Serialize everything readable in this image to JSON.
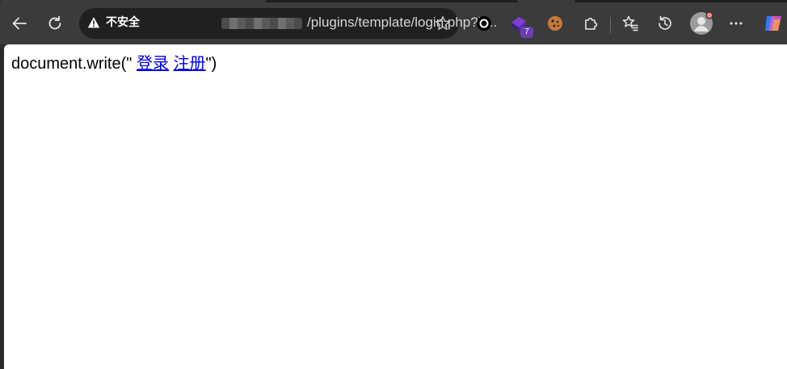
{
  "browser": {
    "address_bar": {
      "security_label": "不安全",
      "url_visible": "/plugins/template/login.php?b..."
    },
    "extensions": [
      {
        "name": "ring-extension-icon"
      },
      {
        "name": "purple-gem-extension-icon",
        "badge": "7"
      },
      {
        "name": "cookie-extension-icon"
      }
    ],
    "colors": {
      "toolbar": "#3b3b3b",
      "omnibox": "#202020",
      "page": "#ffffff",
      "link": "#0000ee"
    }
  },
  "page": {
    "prefix": "document.write(\" ",
    "link_login": "登录",
    "separator": " ",
    "link_register": "注册",
    "suffix": "\")"
  }
}
